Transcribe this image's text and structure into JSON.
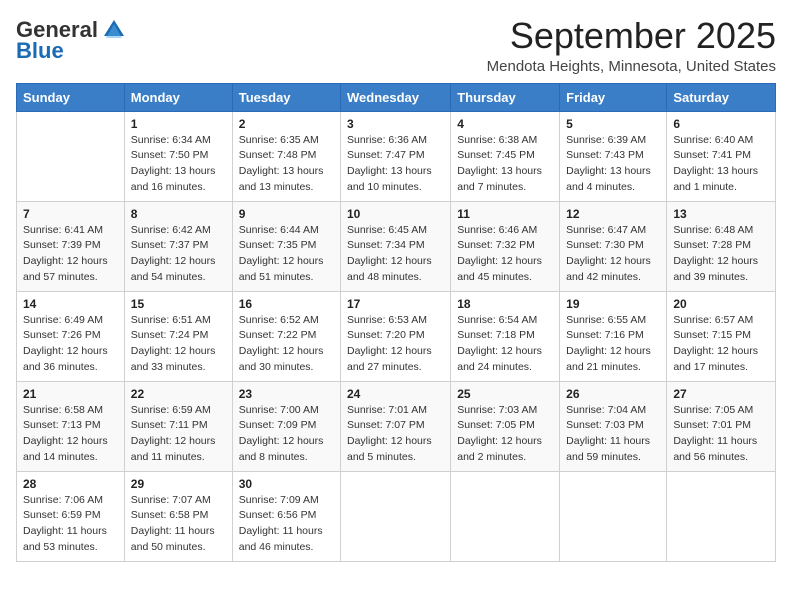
{
  "logo": {
    "general": "General",
    "blue": "Blue"
  },
  "header": {
    "title": "September 2025",
    "subtitle": "Mendota Heights, Minnesota, United States"
  },
  "days_of_week": [
    "Sunday",
    "Monday",
    "Tuesday",
    "Wednesday",
    "Thursday",
    "Friday",
    "Saturday"
  ],
  "weeks": [
    [
      {
        "day": "",
        "sunrise": "",
        "sunset": "",
        "daylight": ""
      },
      {
        "day": "1",
        "sunrise": "Sunrise: 6:34 AM",
        "sunset": "Sunset: 7:50 PM",
        "daylight": "Daylight: 13 hours and 16 minutes."
      },
      {
        "day": "2",
        "sunrise": "Sunrise: 6:35 AM",
        "sunset": "Sunset: 7:48 PM",
        "daylight": "Daylight: 13 hours and 13 minutes."
      },
      {
        "day": "3",
        "sunrise": "Sunrise: 6:36 AM",
        "sunset": "Sunset: 7:47 PM",
        "daylight": "Daylight: 13 hours and 10 minutes."
      },
      {
        "day": "4",
        "sunrise": "Sunrise: 6:38 AM",
        "sunset": "Sunset: 7:45 PM",
        "daylight": "Daylight: 13 hours and 7 minutes."
      },
      {
        "day": "5",
        "sunrise": "Sunrise: 6:39 AM",
        "sunset": "Sunset: 7:43 PM",
        "daylight": "Daylight: 13 hours and 4 minutes."
      },
      {
        "day": "6",
        "sunrise": "Sunrise: 6:40 AM",
        "sunset": "Sunset: 7:41 PM",
        "daylight": "Daylight: 13 hours and 1 minute."
      }
    ],
    [
      {
        "day": "7",
        "sunrise": "Sunrise: 6:41 AM",
        "sunset": "Sunset: 7:39 PM",
        "daylight": "Daylight: 12 hours and 57 minutes."
      },
      {
        "day": "8",
        "sunrise": "Sunrise: 6:42 AM",
        "sunset": "Sunset: 7:37 PM",
        "daylight": "Daylight: 12 hours and 54 minutes."
      },
      {
        "day": "9",
        "sunrise": "Sunrise: 6:44 AM",
        "sunset": "Sunset: 7:35 PM",
        "daylight": "Daylight: 12 hours and 51 minutes."
      },
      {
        "day": "10",
        "sunrise": "Sunrise: 6:45 AM",
        "sunset": "Sunset: 7:34 PM",
        "daylight": "Daylight: 12 hours and 48 minutes."
      },
      {
        "day": "11",
        "sunrise": "Sunrise: 6:46 AM",
        "sunset": "Sunset: 7:32 PM",
        "daylight": "Daylight: 12 hours and 45 minutes."
      },
      {
        "day": "12",
        "sunrise": "Sunrise: 6:47 AM",
        "sunset": "Sunset: 7:30 PM",
        "daylight": "Daylight: 12 hours and 42 minutes."
      },
      {
        "day": "13",
        "sunrise": "Sunrise: 6:48 AM",
        "sunset": "Sunset: 7:28 PM",
        "daylight": "Daylight: 12 hours and 39 minutes."
      }
    ],
    [
      {
        "day": "14",
        "sunrise": "Sunrise: 6:49 AM",
        "sunset": "Sunset: 7:26 PM",
        "daylight": "Daylight: 12 hours and 36 minutes."
      },
      {
        "day": "15",
        "sunrise": "Sunrise: 6:51 AM",
        "sunset": "Sunset: 7:24 PM",
        "daylight": "Daylight: 12 hours and 33 minutes."
      },
      {
        "day": "16",
        "sunrise": "Sunrise: 6:52 AM",
        "sunset": "Sunset: 7:22 PM",
        "daylight": "Daylight: 12 hours and 30 minutes."
      },
      {
        "day": "17",
        "sunrise": "Sunrise: 6:53 AM",
        "sunset": "Sunset: 7:20 PM",
        "daylight": "Daylight: 12 hours and 27 minutes."
      },
      {
        "day": "18",
        "sunrise": "Sunrise: 6:54 AM",
        "sunset": "Sunset: 7:18 PM",
        "daylight": "Daylight: 12 hours and 24 minutes."
      },
      {
        "day": "19",
        "sunrise": "Sunrise: 6:55 AM",
        "sunset": "Sunset: 7:16 PM",
        "daylight": "Daylight: 12 hours and 21 minutes."
      },
      {
        "day": "20",
        "sunrise": "Sunrise: 6:57 AM",
        "sunset": "Sunset: 7:15 PM",
        "daylight": "Daylight: 12 hours and 17 minutes."
      }
    ],
    [
      {
        "day": "21",
        "sunrise": "Sunrise: 6:58 AM",
        "sunset": "Sunset: 7:13 PM",
        "daylight": "Daylight: 12 hours and 14 minutes."
      },
      {
        "day": "22",
        "sunrise": "Sunrise: 6:59 AM",
        "sunset": "Sunset: 7:11 PM",
        "daylight": "Daylight: 12 hours and 11 minutes."
      },
      {
        "day": "23",
        "sunrise": "Sunrise: 7:00 AM",
        "sunset": "Sunset: 7:09 PM",
        "daylight": "Daylight: 12 hours and 8 minutes."
      },
      {
        "day": "24",
        "sunrise": "Sunrise: 7:01 AM",
        "sunset": "Sunset: 7:07 PM",
        "daylight": "Daylight: 12 hours and 5 minutes."
      },
      {
        "day": "25",
        "sunrise": "Sunrise: 7:03 AM",
        "sunset": "Sunset: 7:05 PM",
        "daylight": "Daylight: 12 hours and 2 minutes."
      },
      {
        "day": "26",
        "sunrise": "Sunrise: 7:04 AM",
        "sunset": "Sunset: 7:03 PM",
        "daylight": "Daylight: 11 hours and 59 minutes."
      },
      {
        "day": "27",
        "sunrise": "Sunrise: 7:05 AM",
        "sunset": "Sunset: 7:01 PM",
        "daylight": "Daylight: 11 hours and 56 minutes."
      }
    ],
    [
      {
        "day": "28",
        "sunrise": "Sunrise: 7:06 AM",
        "sunset": "Sunset: 6:59 PM",
        "daylight": "Daylight: 11 hours and 53 minutes."
      },
      {
        "day": "29",
        "sunrise": "Sunrise: 7:07 AM",
        "sunset": "Sunset: 6:58 PM",
        "daylight": "Daylight: 11 hours and 50 minutes."
      },
      {
        "day": "30",
        "sunrise": "Sunrise: 7:09 AM",
        "sunset": "Sunset: 6:56 PM",
        "daylight": "Daylight: 11 hours and 46 minutes."
      },
      {
        "day": "",
        "sunrise": "",
        "sunset": "",
        "daylight": ""
      },
      {
        "day": "",
        "sunrise": "",
        "sunset": "",
        "daylight": ""
      },
      {
        "day": "",
        "sunrise": "",
        "sunset": "",
        "daylight": ""
      },
      {
        "day": "",
        "sunrise": "",
        "sunset": "",
        "daylight": ""
      }
    ]
  ]
}
